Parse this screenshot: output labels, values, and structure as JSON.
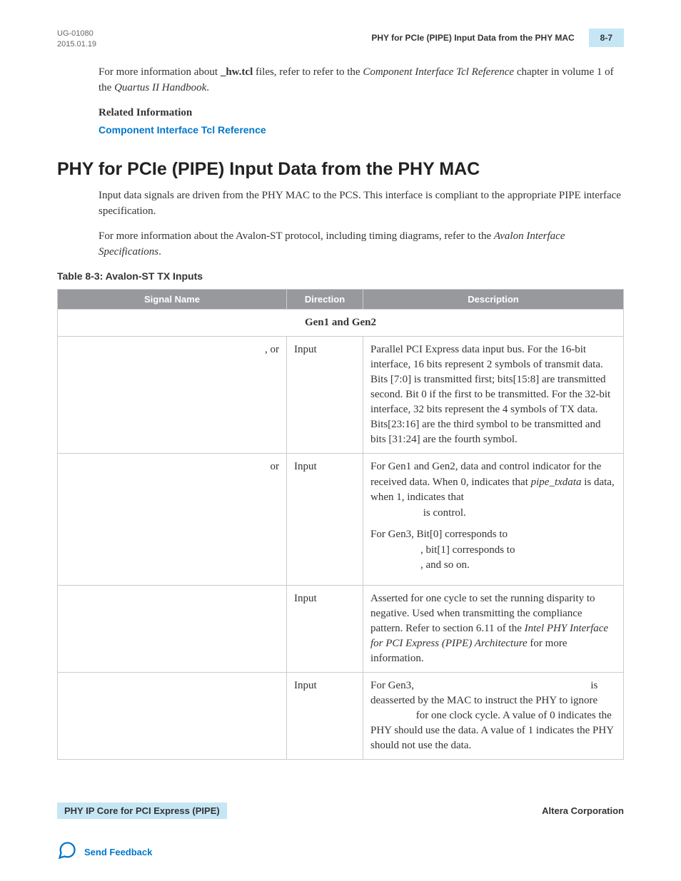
{
  "header": {
    "doc_id": "UG-01080",
    "date": "2015.01.19",
    "chapter_title": "PHY for PCIe (PIPE) Input Data from the PHY MAC",
    "page_number": "8-7"
  },
  "intro": {
    "para1_pre": "For more information about ",
    "para1_bold": "_hw.tcl",
    "para1_mid": " files, refer to refer to the ",
    "para1_italic": "Component Interface Tcl Reference",
    "para1_post": " chapter in volume 1 of the ",
    "para1_italic2": "Quartus II Handbook",
    "para1_end": ".",
    "related_label": "Related Information",
    "related_link": "Component Interface Tcl Reference"
  },
  "section": {
    "title": "PHY for PCIe (PIPE) Input Data from the PHY MAC",
    "para1": "Input data signals are driven from the PHY MAC to the PCS. This interface is compliant to the appropriate PIPE interface specification.",
    "para2_pre": "For more information about the Avalon-ST protocol, including timing diagrams, refer to the ",
    "para2_italic": "Avalon Interface Specifications",
    "para2_end": "."
  },
  "table": {
    "title": "Table 8-3: Avalon-ST TX Inputs",
    "headers": {
      "signal": "Signal Name",
      "direction": "Direction",
      "description": "Description"
    },
    "subheader": "Gen1 and Gen2",
    "rows": [
      {
        "signal": ", or",
        "direction": "Input",
        "desc": "Parallel PCI Express data input bus. For the 16-bit interface, 16 bits represent 2 symbols of transmit data. Bits [7:0] is transmitted first; bits[15:8] are transmitted second. Bit 0 if the first to be transmitted. For the 32-bit interface, 32 bits represent the 4 symbols of TX data. Bits[23:16] are the third symbol to be transmitted and bits [31:24] are the fourth symbol."
      },
      {
        "signal": "or",
        "direction": "Input",
        "desc_p1_a": "For Gen1 and Gen2, data and control indicator for the received data. When 0, indicates that ",
        "desc_p1_italic": "pipe_txdata",
        "desc_p1_b": " is data, when 1, indicates that",
        "desc_p1_c": " is control.",
        "desc_p2_a": "For Gen3, Bit[0] corresponds to",
        "desc_p2_b": ", bit[1] corresponds to",
        "desc_p2_c": ", and so on."
      },
      {
        "signal": "",
        "direction": "Input",
        "desc_a": "Asserted for one cycle to set the running disparity to negative. Used when transmitting the compliance pattern. Refer to section 6.11 of the ",
        "desc_italic": "Intel PHY Interface for PCI Express (PIPE) Architecture",
        "desc_b": " for more information."
      },
      {
        "signal": "",
        "direction": "Input",
        "desc_a": "For Gen3, ",
        "desc_gap1": " is deasserted by the MAC to instruct the PHY to ignore ",
        "desc_gap2": " for one clock cycle. A value of 0 indicates the PHY should use the data. A value of 1 indicates the PHY should not use the data."
      }
    ]
  },
  "footer": {
    "left": "PHY IP Core for PCI Express (PIPE)",
    "right": "Altera Corporation",
    "feedback": "Send Feedback"
  }
}
